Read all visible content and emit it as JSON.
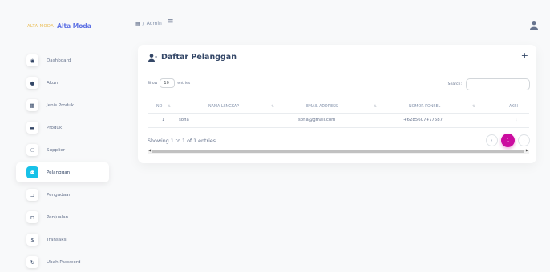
{
  "brand": {
    "logo_text": "ALTA MODA",
    "name": "Alta Moda"
  },
  "sidebar": {
    "items": [
      {
        "label": "Dashboard",
        "icon": "dashboard-icon",
        "glyph": "◉"
      },
      {
        "label": "Akun",
        "icon": "user-icon",
        "glyph": "●"
      },
      {
        "label": "Jenis Produk",
        "icon": "table-icon",
        "glyph": "▦"
      },
      {
        "label": "Produk",
        "icon": "briefcase-icon",
        "glyph": "▬"
      },
      {
        "label": "Supplier",
        "icon": "users-icon",
        "glyph": "⚇"
      },
      {
        "label": "Pelanggan",
        "icon": "user-plus-icon",
        "glyph": "⚉"
      },
      {
        "label": "Pengadaan",
        "icon": "cart-icon",
        "glyph": "⊐"
      },
      {
        "label": "Penjualan",
        "icon": "cash-register-icon",
        "glyph": "⊓"
      },
      {
        "label": "Transaksi",
        "icon": "dollar-icon",
        "glyph": "$"
      },
      {
        "label": "Ubah Password",
        "icon": "refresh-icon",
        "glyph": "↻"
      }
    ],
    "active_index": 5
  },
  "topbar": {
    "breadcrumb_sep": "/",
    "breadcrumb_current": "Admin"
  },
  "card": {
    "title": "Daftar Pelanggan",
    "add_label": "+",
    "show_label": "Show",
    "entries_value": "10",
    "entries_label": "entries",
    "search_label": "Search:",
    "search_placeholder": ""
  },
  "table": {
    "columns": [
      "NO",
      "NAMA LENGKAP",
      "EMAIL ADDRESS",
      "NOMOR PONSEL",
      "AKSI"
    ],
    "rows": [
      {
        "no": "1",
        "nama": "sofia",
        "email": "sofia@gmail.com",
        "ponsel": "+6285607477587",
        "aksi": "⋮"
      }
    ]
  },
  "footer": {
    "info": "Showing 1 to 1 of 1 entries",
    "pages": [
      "‹",
      "1",
      "›"
    ],
    "active_page": "1"
  },
  "colors": {
    "accent": "#cb0c9f",
    "active_icon": "#17c1e8",
    "text": "#344767"
  }
}
